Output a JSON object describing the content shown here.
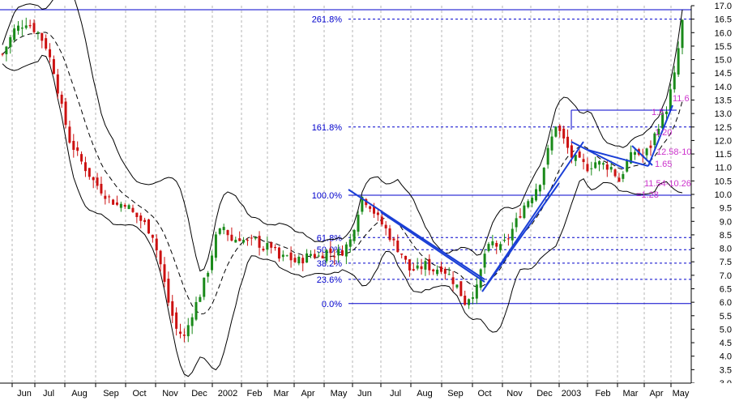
{
  "chart_data": {
    "type": "candlestick",
    "y_axis": {
      "min": 3.0,
      "max": 17.0,
      "ticks": [
        "3.0",
        "3.5",
        "4.0",
        "4.5",
        "5.0",
        "5.5",
        "6.0",
        "6.5",
        "7.0",
        "7.5",
        "8.0",
        "8.5",
        "9.0",
        "9.5",
        "10.0",
        "10.5",
        "11.0",
        "11.5",
        "12.0",
        "12.5",
        "13.0",
        "13.5",
        "14.0",
        "14.5",
        "15.0",
        "15.5",
        "16.0",
        "16.5",
        "17.0"
      ]
    },
    "x_axis": {
      "labels": [
        "Jun",
        "Jul",
        "Aug",
        "Sep",
        "Oct",
        "Nov",
        "Dec",
        "2002",
        "Feb",
        "Mar",
        "Apr",
        "May",
        "Jun",
        "Jul",
        "Aug",
        "Sep",
        "Oct",
        "Nov",
        "Dec",
        "2003",
        "Feb",
        "Mar",
        "Apr",
        "May"
      ]
    },
    "close_path": [
      [
        0,
        15.2
      ],
      [
        3,
        16.1
      ],
      [
        6,
        16.4
      ],
      [
        9,
        16.0
      ],
      [
        11,
        15.5
      ],
      [
        13,
        14.6
      ],
      [
        15,
        13.2
      ],
      [
        17,
        12.0
      ],
      [
        20,
        11.2
      ],
      [
        23,
        10.5
      ],
      [
        26,
        10.0
      ],
      [
        29,
        9.6
      ],
      [
        31,
        9.7
      ],
      [
        33,
        9.3
      ],
      [
        36,
        8.9
      ],
      [
        38,
        8.5
      ],
      [
        40,
        7.4
      ],
      [
        42,
        6.0
      ],
      [
        44,
        5.0
      ],
      [
        46,
        4.7
      ],
      [
        48,
        5.6
      ],
      [
        50,
        6.3
      ],
      [
        52,
        7.2
      ],
      [
        54,
        8.4
      ],
      [
        56,
        8.8
      ],
      [
        58,
        8.3
      ],
      [
        60,
        8.4
      ],
      [
        62,
        8.2
      ],
      [
        64,
        8.3
      ],
      [
        66,
        8.0
      ],
      [
        68,
        8.1
      ],
      [
        70,
        7.6
      ],
      [
        72,
        7.7
      ],
      [
        74,
        7.5
      ],
      [
        76,
        7.6
      ],
      [
        78,
        7.8
      ],
      [
        80,
        7.7
      ],
      [
        82,
        7.9
      ],
      [
        84,
        7.8
      ],
      [
        86,
        7.9
      ],
      [
        88,
        8.3
      ],
      [
        90,
        9.4
      ],
      [
        91,
        9.9
      ],
      [
        93,
        9.6
      ],
      [
        95,
        9.1
      ],
      [
        97,
        8.7
      ],
      [
        99,
        8.2
      ],
      [
        101,
        7.8
      ],
      [
        103,
        7.2
      ],
      [
        105,
        7.2
      ],
      [
        107,
        7.4
      ],
      [
        109,
        7.2
      ],
      [
        111,
        7.3
      ],
      [
        113,
        7.0
      ],
      [
        115,
        6.6
      ],
      [
        117,
        6.0
      ],
      [
        118,
        6.2
      ],
      [
        120,
        6.5
      ],
      [
        122,
        7.8
      ],
      [
        124,
        8.2
      ],
      [
        126,
        8.0
      ],
      [
        128,
        8.4
      ],
      [
        130,
        9.0
      ],
      [
        132,
        9.6
      ],
      [
        134,
        10.0
      ],
      [
        136,
        10.5
      ],
      [
        138,
        11.6
      ],
      [
        140,
        12.6
      ],
      [
        142,
        12.0
      ],
      [
        144,
        11.4
      ],
      [
        146,
        11.2
      ],
      [
        148,
        11.0
      ],
      [
        150,
        11.2
      ],
      [
        152,
        11.1
      ],
      [
        154,
        11.0
      ],
      [
        156,
        10.5
      ],
      [
        158,
        11.2
      ],
      [
        160,
        11.6
      ],
      [
        162,
        11.4
      ],
      [
        164,
        11.8
      ],
      [
        166,
        12.6
      ],
      [
        168,
        13.2
      ],
      [
        170,
        14.4
      ],
      [
        172,
        16.4
      ]
    ],
    "fibonacci": [
      {
        "label": "261.8%",
        "value": 16.5
      },
      {
        "label": "161.8%",
        "value": 12.5
      },
      {
        "label": "100.0%",
        "value": 9.97
      },
      {
        "label": "61.8%",
        "value": 8.4
      },
      {
        "label": "50.0%",
        "value": 7.95
      },
      {
        "label": "38.2%",
        "value": 7.45
      },
      {
        "label": "23.6%",
        "value": 6.85
      },
      {
        "label": "0.0%",
        "value": 5.95
      }
    ],
    "annotations": [
      "11.6",
      "1.6",
      "1.5",
      "1.20",
      "12.58-10",
      "1.65",
      "11.54-10.26",
      "=1.28"
    ]
  }
}
